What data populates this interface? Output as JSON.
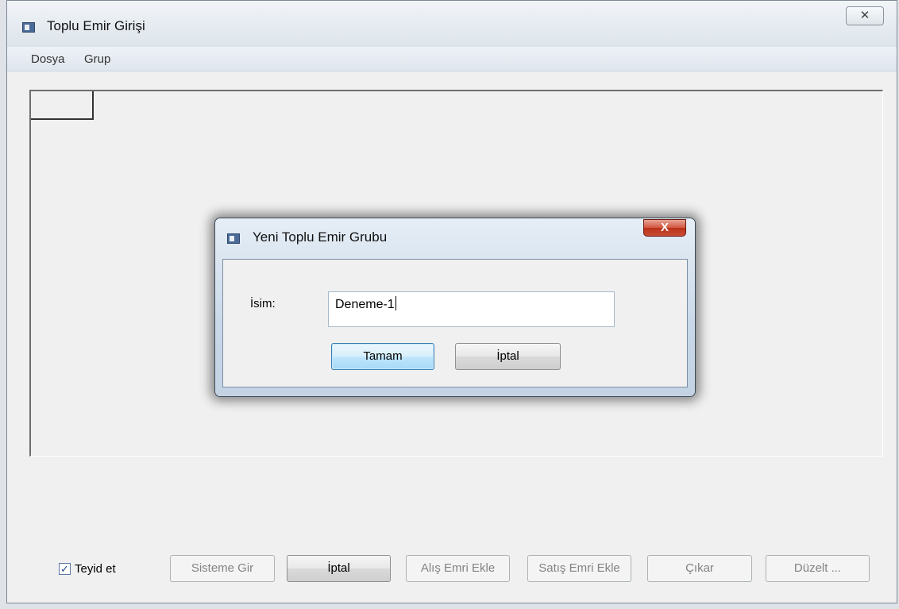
{
  "main_window": {
    "title": "Toplu Emir Girişi",
    "close_symbol": "✕",
    "icon": "app-window-icon"
  },
  "menu": {
    "items": [
      "Dosya",
      "Grup"
    ]
  },
  "footer": {
    "checkbox": {
      "label": "Teyid et",
      "checked": true,
      "mark": "✓"
    },
    "buttons": {
      "sisteme_gir": {
        "label": "Sisteme Gir",
        "enabled": false
      },
      "iptal": {
        "label": "İptal",
        "enabled": true
      },
      "alis_emri_ekle": {
        "label": "Alış Emri Ekle",
        "enabled": false
      },
      "satis_emri_ekle": {
        "label": "Satış Emri Ekle",
        "enabled": false
      },
      "cikar": {
        "label": "Çıkar",
        "enabled": false
      },
      "duzelt": {
        "label": "Düzelt ...",
        "enabled": false
      }
    }
  },
  "dialog": {
    "title": "Yeni Toplu Emir Grubu",
    "close_symbol": "X",
    "name_label": "İsim:",
    "name_value": "Deneme-1",
    "ok_label": "Tamam",
    "cancel_label": "İptal"
  },
  "colors": {
    "dialog_close": "#c94d35",
    "default_button": "#3c7fb1",
    "window_bg": "#f0f0f0"
  }
}
